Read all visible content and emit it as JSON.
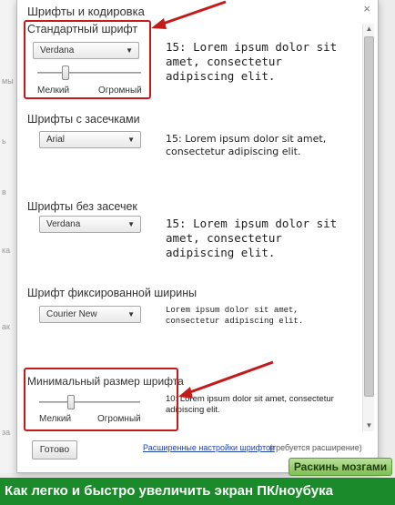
{
  "dialog": {
    "title": "Шрифты и кодировка",
    "close_glyph": "×"
  },
  "sections": {
    "standard": {
      "label": "Стандартный шрифт",
      "font": "Verdana",
      "preview": "15: Lorem ipsum dolor sit amet, consectetur adipiscing elit.",
      "slider_min_label": "Мелкий",
      "slider_max_label": "Огромный",
      "slider_level": 0.25
    },
    "serif": {
      "label": "Шрифты с засечками",
      "font": "Arial",
      "preview": "15: Lorem ipsum dolor sit amet, consectetur adipiscing elit."
    },
    "sans_serif": {
      "label": "Шрифты без засечек",
      "font": "Verdana",
      "preview": "15: Lorem ipsum dolor sit amet, consectetur adipiscing elit."
    },
    "fixed": {
      "label": "Шрифт фиксированной ширины",
      "font": "Courier New",
      "preview": "Lorem ipsum dolor sit amet, consectetur adipiscing elit."
    },
    "minimum": {
      "label": "Минимальный размер шрифта",
      "preview": "10: Lorem ipsum dolor sit amet, consectetur adipiscing elit.",
      "slider_min_label": "Мелкий",
      "slider_max_label": "Огромный",
      "slider_level": 0.3
    }
  },
  "footer": {
    "done_label": "Готово",
    "advanced_link": "Расширенные настройки шрифтов",
    "advanced_note": "(требуется расширение)"
  },
  "watermark_badge": "Раскинь мозгами",
  "banner_text": "Как легко и быстро увеличить экран ПК/ноубука",
  "colors": {
    "highlight": "#c41a1a",
    "banner": "#1a8a2a",
    "link": "#2244aa"
  }
}
